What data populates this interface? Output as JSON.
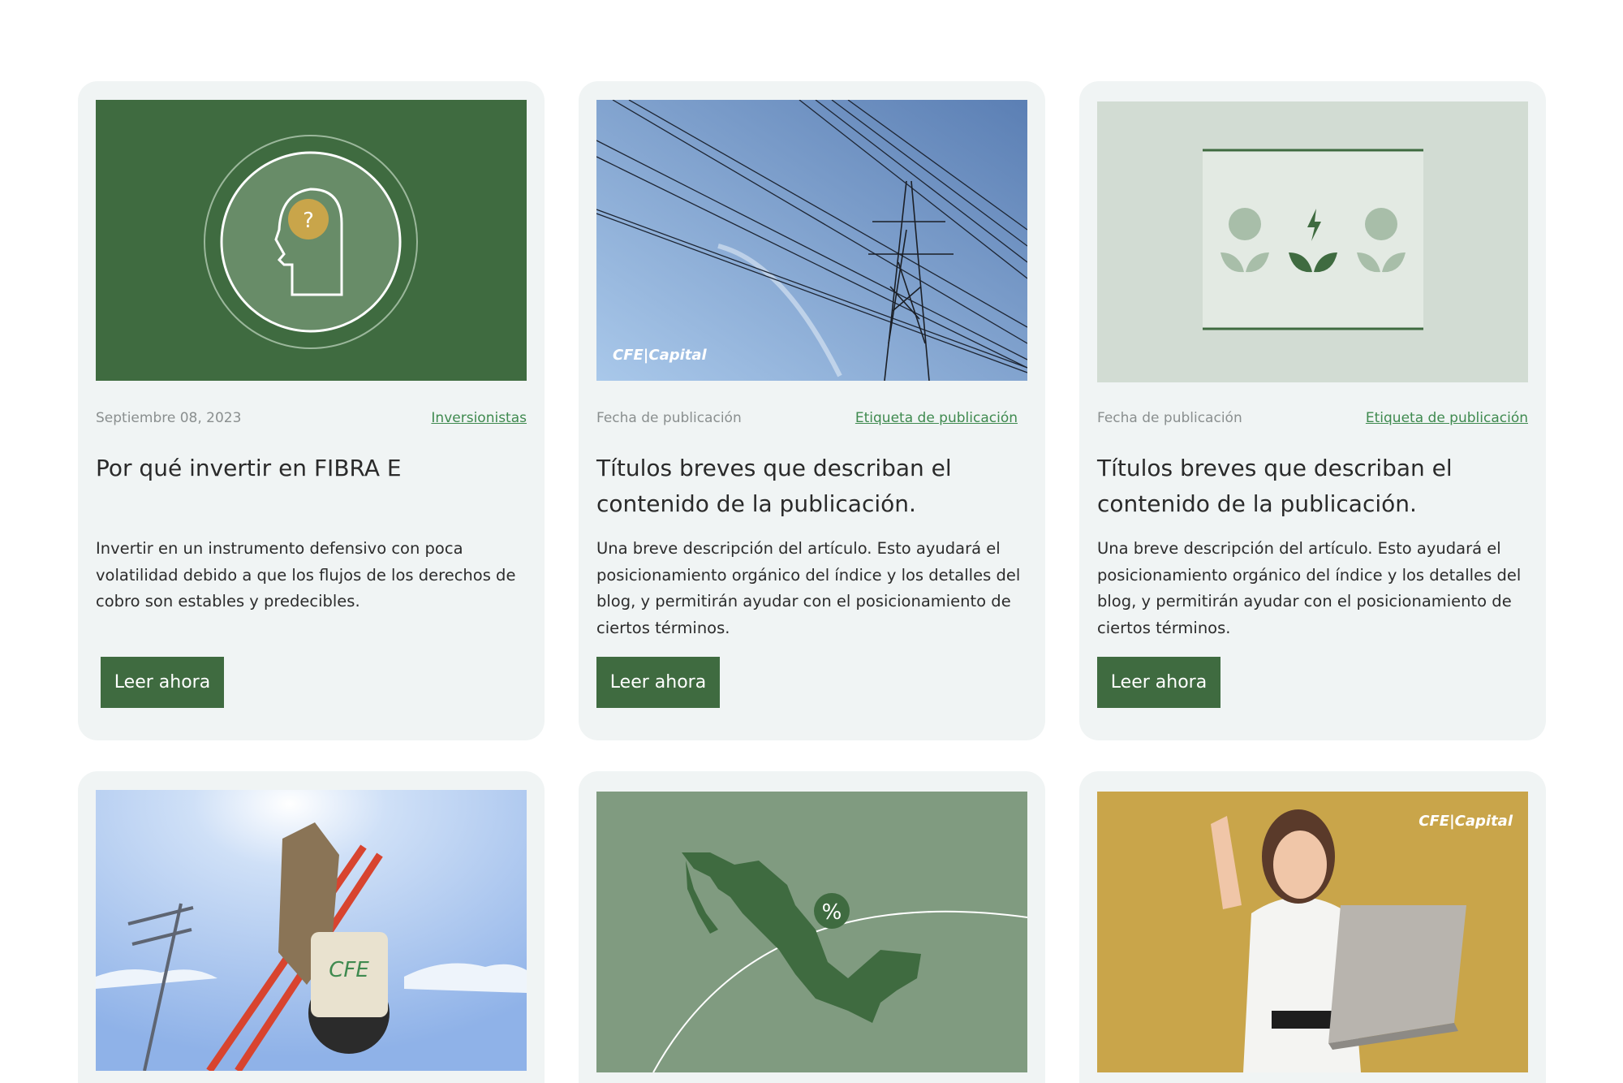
{
  "cards": [
    {
      "date": "Septiembre 08, 2023",
      "tag": "Inversionistas",
      "title": "Por qué invertir en FIBRA E",
      "description": "Invertir en un instrumento defensivo con poca volatilidad debido a que los flujos de los derechos de cobro son estables y predecibles.",
      "button": "Leer ahora",
      "image_glyph": "?"
    },
    {
      "date": "Fecha de publicación",
      "tag": "Etiqueta de publicación",
      "title": "Títulos breves que describan el contenido de la publicación.",
      "description": "Una breve descripción del artículo. Esto ayudará el posicionamiento orgánico del índice y los detalles del blog, y permitirán ayudar con el posicionamiento de ciertos términos.",
      "button": "Leer ahora",
      "image_brand": "CFE|Capital"
    },
    {
      "date": "Fecha de publicación",
      "tag": "Etiqueta de publicación",
      "title": "Títulos breves que describan el contenido de la publicación.",
      "description": "Una breve descripción del artículo. Esto ayudará el posicionamiento orgánico del índice y los detalles del blog, y permitirán ayudar con el posicionamiento de ciertos términos.",
      "button": "Leer ahora"
    },
    {
      "image_brand": "CFE"
    },
    {
      "image_glyph": "%"
    },
    {
      "image_brand": "CFE|Capital"
    }
  ],
  "colors": {
    "brand_green": "#3f6b40",
    "tag_green": "#3f8a4f",
    "card_bg": "#f0f4f4",
    "gold": "#c9a54a"
  },
  "icons": [
    "head-question-icon",
    "bolt-icon",
    "leaf-icon"
  ]
}
